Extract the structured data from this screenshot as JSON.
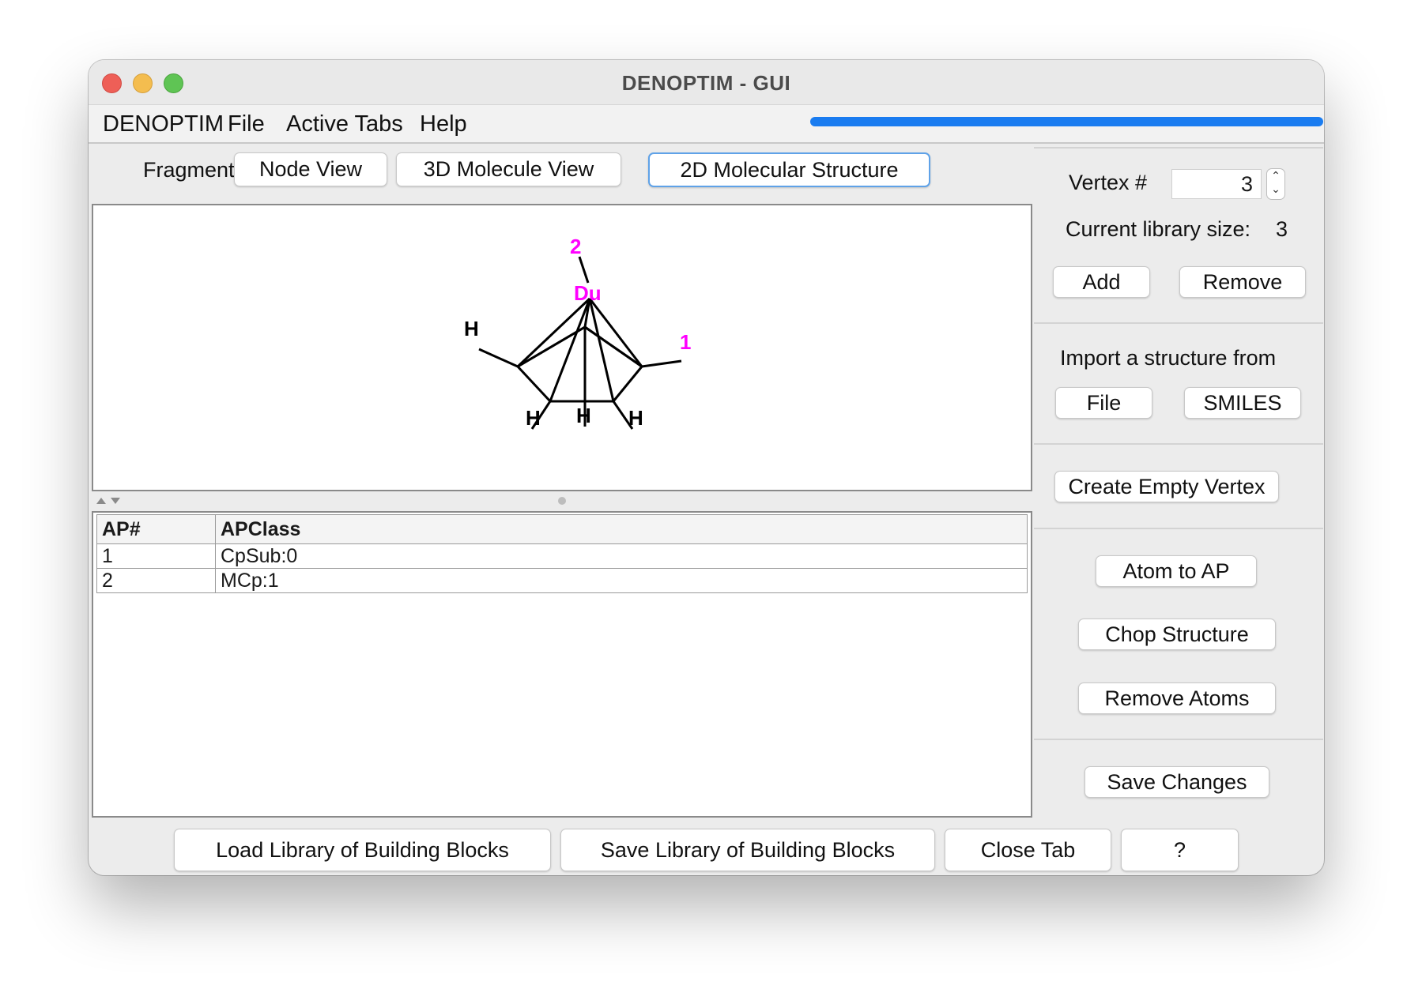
{
  "window": {
    "title": "DENOPTIM - GUI"
  },
  "menu": [
    "DENOPTIM",
    "File",
    "Active Tabs",
    "Help"
  ],
  "view_selector": {
    "label": "Fragment",
    "buttons": [
      "Node View",
      "3D Molecule View",
      "2D Molecular Structure"
    ],
    "selected": "2D Molecular Structure"
  },
  "molecule": {
    "atoms": {
      "dummy": "Du",
      "hydrogen": "H"
    },
    "ap_labels": [
      "1",
      "2"
    ],
    "colors": {
      "ap": "#ff00ff",
      "bond": "#000000"
    }
  },
  "ap_table": {
    "headers": [
      "AP#",
      "APClass"
    ],
    "rows": [
      {
        "ap": "1",
        "apclass": "CpSub:0"
      },
      {
        "ap": "2",
        "apclass": "MCp:1"
      }
    ]
  },
  "side_panel": {
    "vertex_label": "Vertex #",
    "vertex_value": "3",
    "library_size_label": "Current library size:",
    "library_size_value": "3",
    "add": "Add",
    "remove": "Remove",
    "import_label": "Import a structure from",
    "import_file": "File",
    "import_smiles": "SMILES",
    "create_empty": "Create Empty Vertex",
    "atom_to_ap": "Atom to AP",
    "chop_structure": "Chop Structure",
    "remove_atoms": "Remove Atoms",
    "save_changes": "Save Changes"
  },
  "bottom_bar": {
    "load": "Load Library of Building Blocks",
    "save": "Save Library of Building Blocks",
    "close": "Close Tab",
    "help": "?"
  }
}
